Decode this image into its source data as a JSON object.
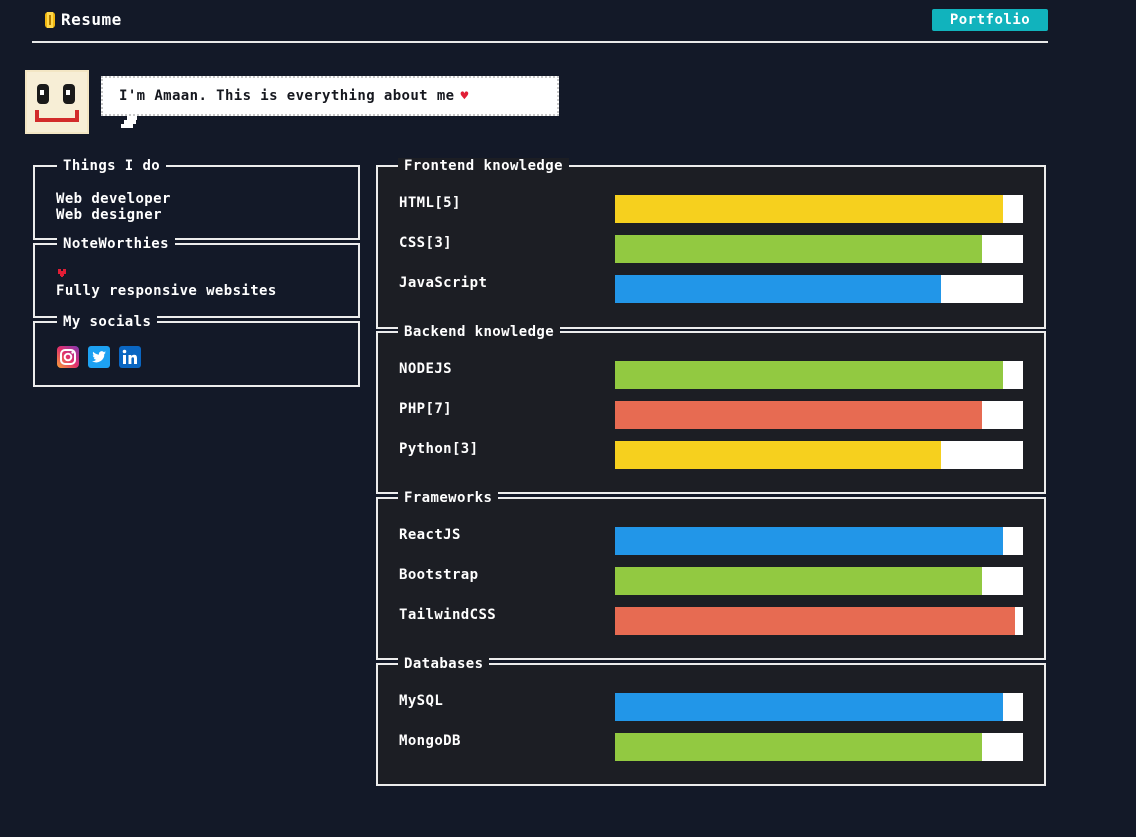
{
  "header": {
    "brand_label": "Resume",
    "portfolio_label": "Portfolio"
  },
  "intro": {
    "text": "I'm Amaan. This is everything about me",
    "heart": "♥"
  },
  "things_i_do": {
    "title": "Things I do",
    "items": [
      "Web developer",
      "Web designer"
    ]
  },
  "noteworthies": {
    "title": "NoteWorthies",
    "item": "Fully responsive websites"
  },
  "socials": {
    "title": "My socials",
    "icons": [
      "instagram-icon",
      "twitter-icon",
      "linkedin-icon"
    ]
  },
  "colors": {
    "background": "#131928",
    "panel": "#1c1e24",
    "accent": "#11b3bd",
    "yellow": "#f6d01e",
    "green": "#92c941",
    "blue": "#2296e8",
    "red": "#e76b52"
  },
  "skills": [
    {
      "title": "Frontend knowledge",
      "items": [
        {
          "label": "HTML[5]",
          "percent": 95,
          "color": "#f6d01e"
        },
        {
          "label": "CSS[3]",
          "percent": 90,
          "color": "#92c941"
        },
        {
          "label": "JavaScript",
          "percent": 80,
          "color": "#2296e8"
        }
      ]
    },
    {
      "title": "Backend knowledge",
      "items": [
        {
          "label": "NODEJS",
          "percent": 95,
          "color": "#92c941"
        },
        {
          "label": "PHP[7]",
          "percent": 90,
          "color": "#e76b52"
        },
        {
          "label": "Python[3]",
          "percent": 80,
          "color": "#f6d01e"
        }
      ]
    },
    {
      "title": "Frameworks",
      "items": [
        {
          "label": "ReactJS",
          "percent": 95,
          "color": "#2296e8"
        },
        {
          "label": "Bootstrap",
          "percent": 90,
          "color": "#92c941"
        },
        {
          "label": "TailwindCSS",
          "percent": 98,
          "color": "#e76b52"
        }
      ]
    },
    {
      "title": "Databases",
      "items": [
        {
          "label": "MySQL",
          "percent": 95,
          "color": "#2296e8"
        },
        {
          "label": "MongoDB",
          "percent": 90,
          "color": "#92c941"
        }
      ]
    }
  ]
}
